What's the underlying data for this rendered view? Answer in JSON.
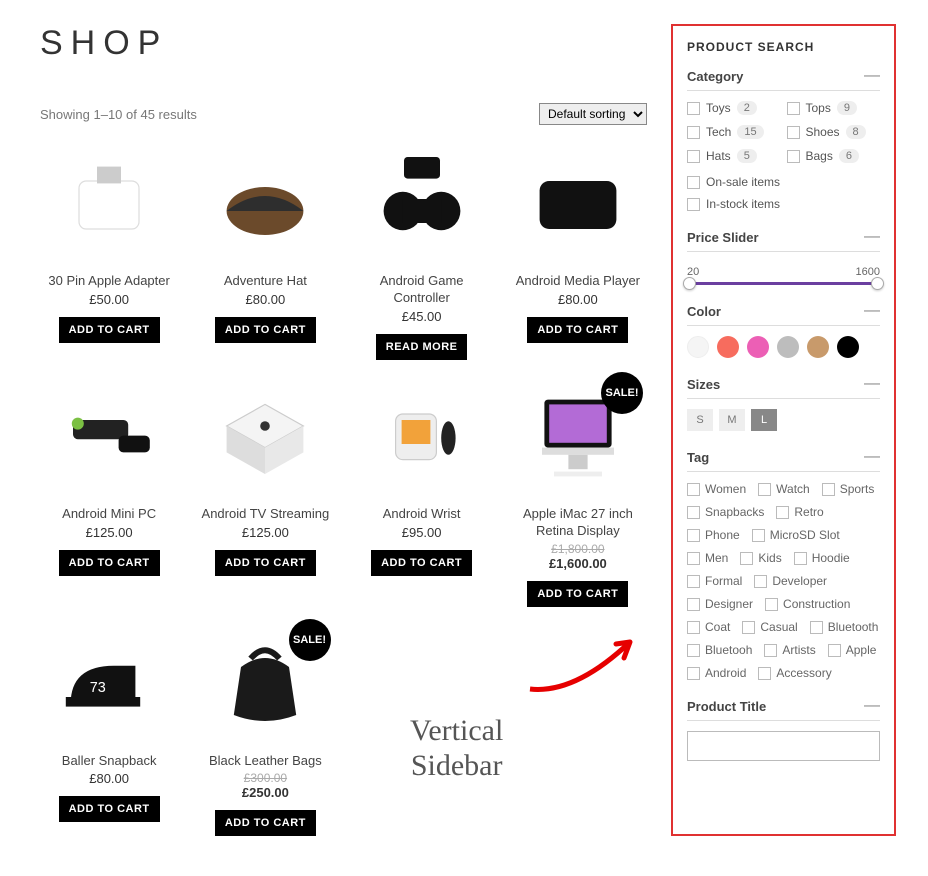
{
  "page_title": "SHOP",
  "result_text": "Showing 1–10 of 45 results",
  "sort_label": "Default sorting",
  "add_to_cart": "ADD TO CART",
  "read_more": "READ MORE",
  "sale_badge": "SALE!",
  "products": [
    {
      "name": "30 Pin Apple Adapter",
      "price": "£50.00",
      "btn": "cart"
    },
    {
      "name": "Adventure Hat",
      "price": "£80.00",
      "btn": "cart"
    },
    {
      "name": "Android Game Controller",
      "price": "£45.00",
      "btn": "read"
    },
    {
      "name": "Android Media Player",
      "price": "£80.00",
      "btn": "cart"
    },
    {
      "name": "Android Mini PC",
      "price": "£125.00",
      "btn": "cart"
    },
    {
      "name": "Android TV Streaming",
      "price": "£125.00",
      "btn": "cart"
    },
    {
      "name": "Android Wrist",
      "price": "£95.00",
      "btn": "cart"
    },
    {
      "name": "Apple iMac 27 inch Retina Display",
      "old": "£1,800.00",
      "price": "£1,600.00",
      "btn": "cart",
      "sale": true
    },
    {
      "name": "Baller Snapback",
      "price": "£80.00",
      "btn": "cart"
    },
    {
      "name": "Black Leather Bags",
      "old": "£300.00",
      "price": "£250.00",
      "btn": "cart",
      "sale": true
    }
  ],
  "sidebar": {
    "title": "PRODUCT SEARCH",
    "category": {
      "label": "Category",
      "items": [
        {
          "name": "Toys",
          "c": "2"
        },
        {
          "name": "Tops",
          "c": "9"
        },
        {
          "name": "Tech",
          "c": "15"
        },
        {
          "name": "Shoes",
          "c": "8"
        },
        {
          "name": "Hats",
          "c": "5"
        },
        {
          "name": "Bags",
          "c": "6"
        }
      ],
      "opts": [
        "On-sale items",
        "In-stock items"
      ]
    },
    "price": {
      "label": "Price Slider",
      "min": "20",
      "max": "1600"
    },
    "color": {
      "label": "Color",
      "swatches": [
        "#f5f5f5",
        "#f76c5e",
        "#ec5fb5",
        "#bdbdbd",
        "#c89a6b",
        "#000000"
      ]
    },
    "sizes": {
      "label": "Sizes",
      "items": [
        "S",
        "M",
        "L"
      ],
      "selected": "L"
    },
    "tags": {
      "label": "Tag",
      "items": [
        "Women",
        "Watch",
        "Sports",
        "Snapbacks",
        "Retro",
        "Phone",
        "MicroSD Slot",
        "Men",
        "Kids",
        "Hoodie",
        "Formal",
        "Developer",
        "Designer",
        "Construction",
        "Coat",
        "Casual",
        "Bluetooth",
        "Bluetooh",
        "Artists",
        "Apple",
        "Android",
        "Accessory"
      ]
    },
    "title_search": {
      "label": "Product Title",
      "value": ""
    }
  },
  "annotation": "Vertical\nSidebar"
}
